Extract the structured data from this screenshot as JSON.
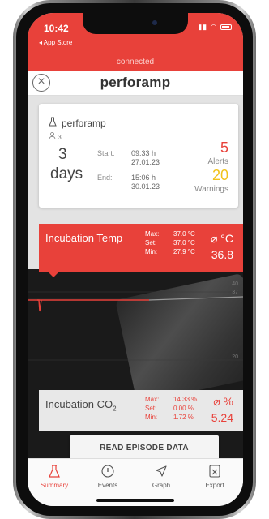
{
  "status_bar": {
    "time": "10:42",
    "back_link": "◂ App Store"
  },
  "connection": {
    "status": "connected"
  },
  "header": {
    "title": "perforamp"
  },
  "episode": {
    "device_name": "perforamp",
    "user_count": "3",
    "duration_value": "3",
    "duration_unit": "days",
    "start_label": "Start:",
    "start_time": "09:33 h",
    "start_date": "27.01.23",
    "end_label": "End:",
    "end_time": "15:06 h",
    "end_date": "30.01.23",
    "alerts_count": "5",
    "alerts_label": "Alerts",
    "warnings_count": "20",
    "warnings_label": "Warnings"
  },
  "incubation_temp": {
    "title": "Incubation Temp",
    "max_label": "Max:",
    "max_value": "37.0 °C",
    "set_label": "Set:",
    "set_value": "37.0 °C",
    "min_label": "Min:",
    "min_value": "27.9 °C",
    "avg_symbol": "⌀ °C",
    "avg_value": "36.8"
  },
  "graph": {
    "axis_top": "40",
    "axis_mid": "37",
    "axis_low": "20"
  },
  "incubation_co2": {
    "title": "Incubation CO",
    "title_sub": "2",
    "max_label": "Max:",
    "max_value": "14.33 %",
    "set_label": "Set:",
    "set_value": "0.00 %",
    "min_label": "Min:",
    "min_value": "1.72 %",
    "avg_symbol": "⌀ %",
    "avg_value": "5.24"
  },
  "actions": {
    "read_episode": "READ EPISODE DATA"
  },
  "tabs": [
    {
      "label": "Summary",
      "icon": "flask-icon"
    },
    {
      "label": "Events",
      "icon": "events-icon"
    },
    {
      "label": "Graph",
      "icon": "navigation-icon"
    },
    {
      "label": "Export",
      "icon": "xls-file-icon"
    }
  ],
  "colors": {
    "accent": "#e8413a",
    "warning": "#f1c21b"
  }
}
